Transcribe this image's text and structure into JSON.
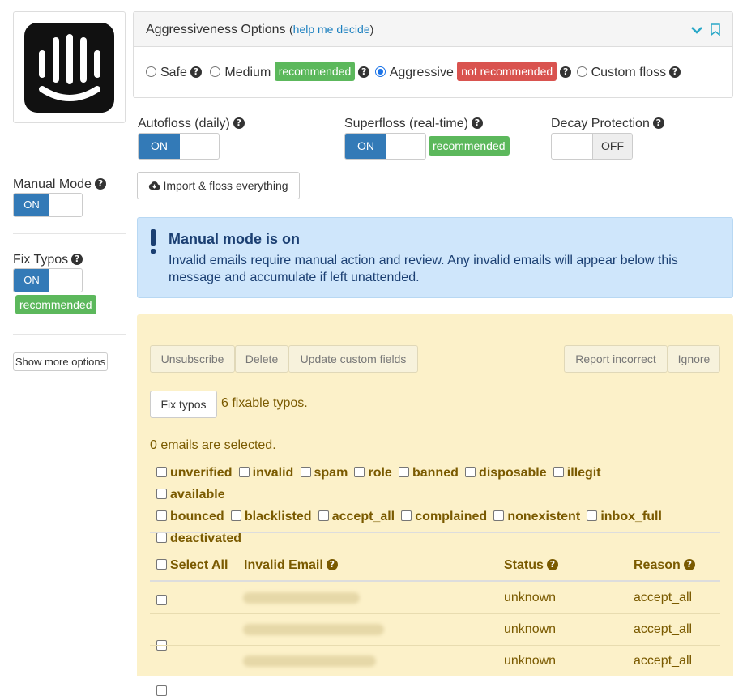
{
  "aggressiveness": {
    "title": "Aggressiveness Options",
    "help_open": "(",
    "help_link": "help me decide",
    "help_close": ")",
    "options": [
      {
        "label": "Safe",
        "selected": false
      },
      {
        "label": "Medium",
        "badge": "recommended",
        "selected": false
      },
      {
        "label": "Aggressive",
        "badge": "not recommended",
        "selected": true
      },
      {
        "label": "Custom floss",
        "selected": false
      }
    ]
  },
  "autofloss": {
    "label": "Autofloss (daily)",
    "state": "ON"
  },
  "superfloss": {
    "label": "Superfloss (real-time)",
    "state": "ON",
    "badge": "recommended"
  },
  "decay": {
    "label": "Decay Protection",
    "state": "OFF"
  },
  "manual_mode": {
    "label": "Manual Mode",
    "state": "ON"
  },
  "import_button": "Import & floss everything",
  "fix_typos": {
    "label": "Fix Typos",
    "state": "ON",
    "badge": "recommended"
  },
  "show_more": "Show more options",
  "alert": {
    "title": "Manual mode is on",
    "body": "Invalid emails require manual action and review. Any invalid emails will appear below this message and accumulate if left unattended."
  },
  "actions": {
    "unsubscribe": "Unsubscribe",
    "delete": "Delete",
    "update_custom": "Update custom fields",
    "report_incorrect": "Report incorrect",
    "ignore": "Ignore",
    "fix_typos": "Fix typos",
    "fixable_count": "6 fixable typos.",
    "selected_text": "0 emails are selected."
  },
  "filters": [
    "unverified",
    "invalid",
    "spam",
    "role",
    "banned",
    "disposable",
    "illegit",
    "available",
    "bounced",
    "blacklisted",
    "accept_all",
    "complained",
    "nonexistent",
    "inbox_full",
    "deactivated"
  ],
  "table": {
    "headers": {
      "select_all": "Select All",
      "email": "Invalid Email",
      "status": "Status",
      "reason": "Reason"
    },
    "rows": [
      {
        "status": "unknown",
        "reason": "accept_all"
      },
      {
        "status": "unknown",
        "reason": "accept_all"
      },
      {
        "status": "unknown",
        "reason": "accept_all"
      }
    ]
  },
  "colors": {
    "primary": "#337ab7",
    "success": "#5cb85c",
    "danger": "#d9534f",
    "alert_bg": "#cfe6fb",
    "panel_bg": "#fcf1c9",
    "gold_text": "#7a5a00"
  }
}
